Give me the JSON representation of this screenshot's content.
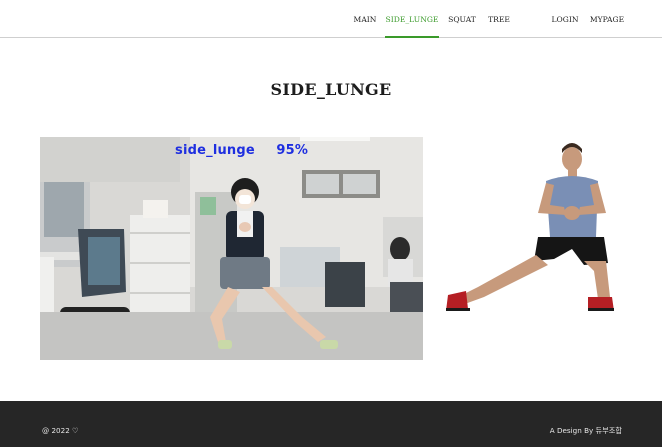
{
  "nav": {
    "items": [
      {
        "label": "MAIN",
        "active": false
      },
      {
        "label": "SIDE_LUNGE",
        "active": true
      },
      {
        "label": "SQUAT",
        "active": false
      },
      {
        "label": "TREE",
        "active": false
      }
    ],
    "right_items": [
      {
        "label": "LOGIN"
      },
      {
        "label": "MYPAGE"
      }
    ],
    "accent_color": "#3a9a2a"
  },
  "page": {
    "title": "SIDE_LUNGE"
  },
  "webcam": {
    "prediction_label": "side_lunge",
    "confidence": "95%",
    "label_color": "#1f2fe0"
  },
  "footer": {
    "copyright": "@ 2022 ♡",
    "credit": "A Design By 듀부조합"
  }
}
